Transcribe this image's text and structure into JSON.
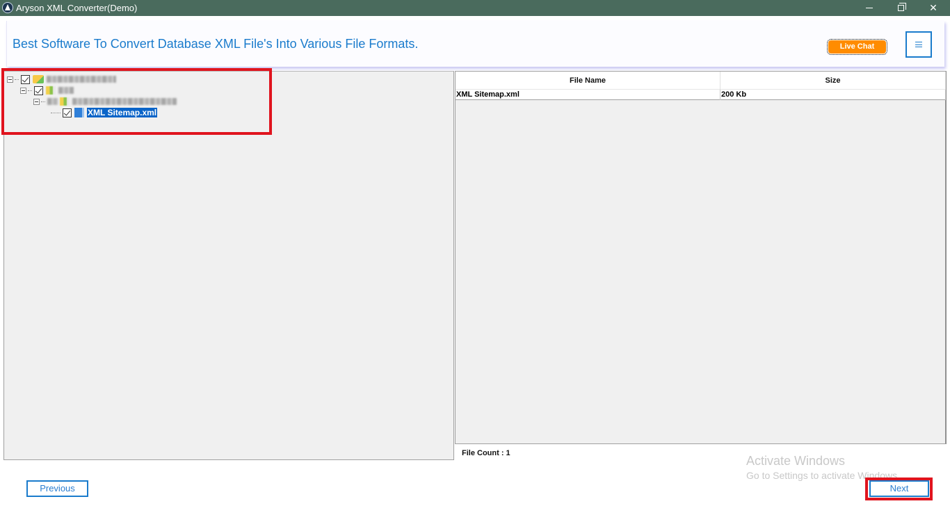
{
  "window": {
    "title": "Aryson XML Converter(Demo)",
    "controls": {
      "minimize": "minimize",
      "restore": "restore",
      "close": "close"
    }
  },
  "banner": {
    "headline": "Best Software To Convert Database XML File's Into Various File Formats.",
    "live_chat_label": "Live Chat",
    "menu_icon": "hamburger-menu-icon"
  },
  "tree": {
    "nodes": [
      {
        "level": 0,
        "checked": true,
        "icon": "folder-checked-icon",
        "label": "[blurred]",
        "blurred": true,
        "expanded": true
      },
      {
        "level": 1,
        "checked": true,
        "icon": "database-icon",
        "label": "[blurred]",
        "blurred": true,
        "expanded": true
      },
      {
        "level": 2,
        "checked": false,
        "icon": "database-icon",
        "label": "[blurred]",
        "blurred": true,
        "expanded": true
      },
      {
        "level": 3,
        "checked": true,
        "icon": "xml-file-icon",
        "label": "XML Sitemap.xml",
        "blurred": false,
        "selected": true
      }
    ]
  },
  "grid": {
    "columns": [
      "File Name",
      "Size"
    ],
    "rows": [
      {
        "file_name": "XML Sitemap.xml",
        "size": "200 Kb"
      }
    ],
    "file_count_label": "File Count : 1"
  },
  "watermark": {
    "line1": "Activate Windows",
    "line2": "Go to Settings to activate Windows."
  },
  "footer": {
    "previous_label": "Previous",
    "next_label": "Next"
  },
  "colors": {
    "titlebar": "#4a6b5d",
    "accent": "#1a7bcc",
    "live_chat": "#ff8c00",
    "highlight": "#e0141e",
    "selection": "#0a64c8"
  }
}
